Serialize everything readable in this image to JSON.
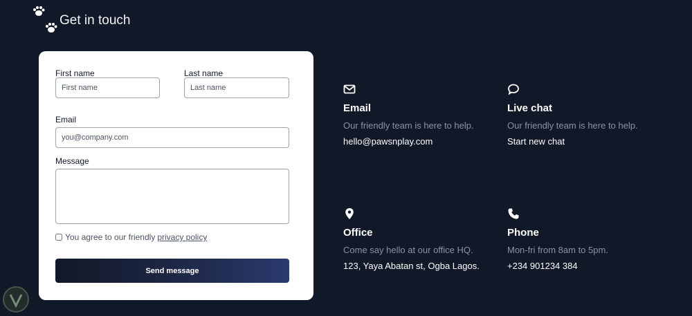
{
  "header": {
    "title": "Get in touch",
    "logo_icon": "paw-prints-icon"
  },
  "form": {
    "first_name": {
      "label": "First name",
      "placeholder": "First name",
      "value": ""
    },
    "last_name": {
      "label": "Last name",
      "placeholder": "Last name",
      "value": ""
    },
    "email": {
      "label": "Email",
      "placeholder": "you@company.com",
      "value": ""
    },
    "message": {
      "label": "Message",
      "value": ""
    },
    "agree": {
      "text": "You agree to our friendly",
      "link": "privacy policy",
      "checked": false
    },
    "submit_label": "Send message"
  },
  "contacts": [
    {
      "icon": "envelope-icon",
      "title": "Email",
      "description": "Our friendly team is here to help.",
      "value": "hello@pawsnplay.com"
    },
    {
      "icon": "chat-bubble-icon",
      "title": "Live chat",
      "description": "Our friendly team is here to help.",
      "value": "Start new chat"
    },
    {
      "icon": "map-pin-icon",
      "title": "Office",
      "description": "Come say hello at our office HQ.",
      "value": "123, Yaya Abatan st, Ogba Lagos."
    },
    {
      "icon": "phone-icon",
      "title": "Phone",
      "description": "Mon-fri from 8am to 5pm.",
      "value": "+234 901234 384"
    }
  ],
  "colors": {
    "background": "#111827",
    "card": "#ffffff",
    "muted": "#8b94a3",
    "button_start": "#111827",
    "button_end": "#2a3a6e"
  }
}
